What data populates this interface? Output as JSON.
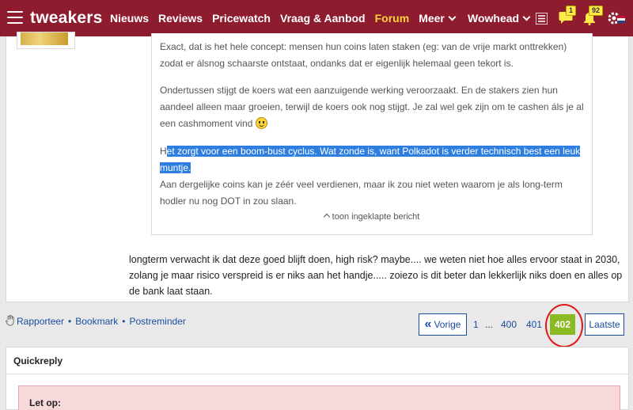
{
  "header": {
    "logo": "tweakers",
    "nav": [
      "Nieuws",
      "Reviews",
      "Pricewatch",
      "Vraag & Aanbod",
      "Forum",
      "Meer"
    ],
    "active_nav": "Forum",
    "user": "Wowhead",
    "chat_badge": "1",
    "notification_badge": "92"
  },
  "quote": {
    "para1": "Exact, dat is het hele concept: mensen hun coins laten staken (eg: van de vrije markt onttrekken) zodat er álsnog schaarste ontstaat, ondanks dat er eigenlijk helemaal geen tekort is.",
    "para2": "Ondertussen stijgt de koers wat een aanzuigende werking veroorzaakt. En de stakers zien hun aandeel alleen maar groeien, terwijl de koers ook nog stijgt. Je zal wel gek zijn om te cashen áls je al een cashmoment vind",
    "para3_plain": "H",
    "para3_selected": "et zorgt voor een boom-bust cyclus. Wat zonde is, want Polkadot is verder technisch best een leuk muntje.",
    "para4": "Aan dergelijke coins kan je zéér veel verdienen, maar ik zou niet weten waarom je als long-term hodler nu nog DOT in zou slaan.",
    "expand_label": "toon ingeklapte bericht"
  },
  "reply_text": "longterm verwacht ik dat deze goed blijft doen, high risk? maybe.... we weten niet hoe alles ervoor staat in 2030, zolang je maar risico verspreid is er niks aan het handje..... zoiezo is dit beter dan lekkerlijk niks doen en alles op de bank laat staan.",
  "actions": {
    "report": "Rapporteer",
    "bookmark": "Bookmark",
    "reminder": "Postreminder"
  },
  "pagination": {
    "prev": "Vorige",
    "first": "1",
    "ellipsis": "...",
    "p400": "400",
    "p401": "401",
    "current": "402",
    "last": "Laatste"
  },
  "quickreply": {
    "title": "Quickreply",
    "notice_title": "Let op:"
  },
  "colors": {
    "brand": "#8d1c2e",
    "active_nav": "#ffd23c",
    "selection": "#2e7ee0",
    "current_page": "#8ab923",
    "annotation_circle": "#e01818"
  }
}
